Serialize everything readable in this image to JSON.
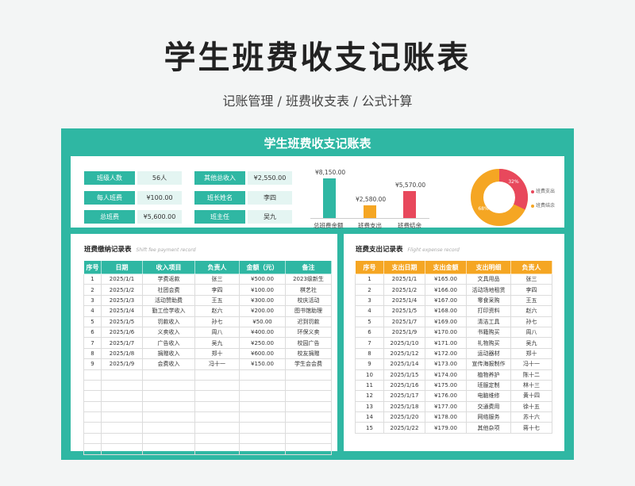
{
  "hero": {
    "title": "学生班费收支记账表",
    "subtitle": "记账管理 / 班费收支表  / 公式计算"
  },
  "sheet_title": "学生班费收支记账表",
  "summary": {
    "items": [
      {
        "label": "班级人数",
        "value": "56人"
      },
      {
        "label": "每人班费",
        "value": "¥100.00"
      },
      {
        "label": "总班费",
        "value": "¥5,600.00"
      },
      {
        "label": "其他总收入",
        "value": "¥2,550.00"
      },
      {
        "label": "班长姓名",
        "value": "李四"
      },
      {
        "label": "班主任",
        "value": "吴九"
      }
    ]
  },
  "chart_data": [
    {
      "type": "bar",
      "categories": [
        "总班费金额",
        "班费支出",
        "班费结余"
      ],
      "values": [
        8150,
        2580,
        5570
      ],
      "data_labels": [
        "¥8,150.00",
        "¥2,580.00",
        "¥5,570.00"
      ],
      "colors": [
        "#2fb7a3",
        "#f5a623",
        "#e8485c"
      ]
    },
    {
      "type": "pie",
      "donut": true,
      "series": [
        {
          "name": "班费支出",
          "value": 32,
          "label": "32%",
          "color": "#e8485c"
        },
        {
          "name": "班费结余",
          "value": 68,
          "label": "68%",
          "color": "#f5a623"
        }
      ],
      "legend": "right"
    }
  ],
  "income": {
    "title": "班费缴纳记录表",
    "title_en": "Shift fee payment record",
    "headers": [
      "序号",
      "日期",
      "收入项目",
      "负责人",
      "金额（元）",
      "备注"
    ],
    "rows": [
      [
        "1",
        "2025/1/1",
        "学费返款",
        "张三",
        "¥500.00",
        "2023级新生"
      ],
      [
        "2",
        "2025/1/2",
        "社团会费",
        "李四",
        "¥100.00",
        "棋艺社"
      ],
      [
        "3",
        "2025/1/3",
        "活动赞助费",
        "王五",
        "¥300.00",
        "校庆活动"
      ],
      [
        "4",
        "2025/1/4",
        "勤工俭学收入",
        "赵六",
        "¥200.00",
        "图书馆助理"
      ],
      [
        "5",
        "2025/1/5",
        "罚款收入",
        "孙七",
        "¥50.00",
        "迟到罚款"
      ],
      [
        "6",
        "2025/1/6",
        "义卖收入",
        "周八",
        "¥400.00",
        "环保义卖"
      ],
      [
        "7",
        "2025/1/7",
        "广告收入",
        "吴九",
        "¥250.00",
        "校园广告"
      ],
      [
        "8",
        "2025/1/8",
        "捐赠收入",
        "郑十",
        "¥600.00",
        "校友捐赠"
      ],
      [
        "9",
        "2025/1/9",
        "会费收入",
        "冯十一",
        "¥150.00",
        "学生会会费"
      ]
    ]
  },
  "expense": {
    "title": "班费支出记录表",
    "title_en": "Flight expense record",
    "headers": [
      "序号",
      "支出日期",
      "支出金额",
      "支出明细",
      "负责人"
    ],
    "rows": [
      [
        "1",
        "2025/1/1",
        "¥165.00",
        "文具用品",
        "张三"
      ],
      [
        "2",
        "2025/1/2",
        "¥166.00",
        "活动场地租赁",
        "李四"
      ],
      [
        "3",
        "2025/1/4",
        "¥167.00",
        "零食采购",
        "王五"
      ],
      [
        "4",
        "2025/1/5",
        "¥168.00",
        "打印资料",
        "赵六"
      ],
      [
        "5",
        "2025/1/7",
        "¥169.00",
        "清洁工具",
        "孙七"
      ],
      [
        "6",
        "2025/1/9",
        "¥170.00",
        "书籍购买",
        "周八"
      ],
      [
        "7",
        "2025/1/10",
        "¥171.00",
        "礼物购买",
        "吴九"
      ],
      [
        "8",
        "2025/1/12",
        "¥172.00",
        "运动器材",
        "郑十"
      ],
      [
        "9",
        "2025/1/14",
        "¥173.00",
        "宣传海报制作",
        "冯十一"
      ],
      [
        "10",
        "2025/1/15",
        "¥174.00",
        "植物养护",
        "陈十二"
      ],
      [
        "11",
        "2025/1/16",
        "¥175.00",
        "班服定制",
        "林十三"
      ],
      [
        "12",
        "2025/1/17",
        "¥176.00",
        "电脑维修",
        "黄十四"
      ],
      [
        "13",
        "2025/1/18",
        "¥177.00",
        "交通费用",
        "徐十五"
      ],
      [
        "14",
        "2025/1/20",
        "¥178.00",
        "网络服务",
        "苏十六"
      ],
      [
        "15",
        "2025/1/22",
        "¥179.00",
        "其他杂项",
        "蒋十七"
      ]
    ]
  }
}
